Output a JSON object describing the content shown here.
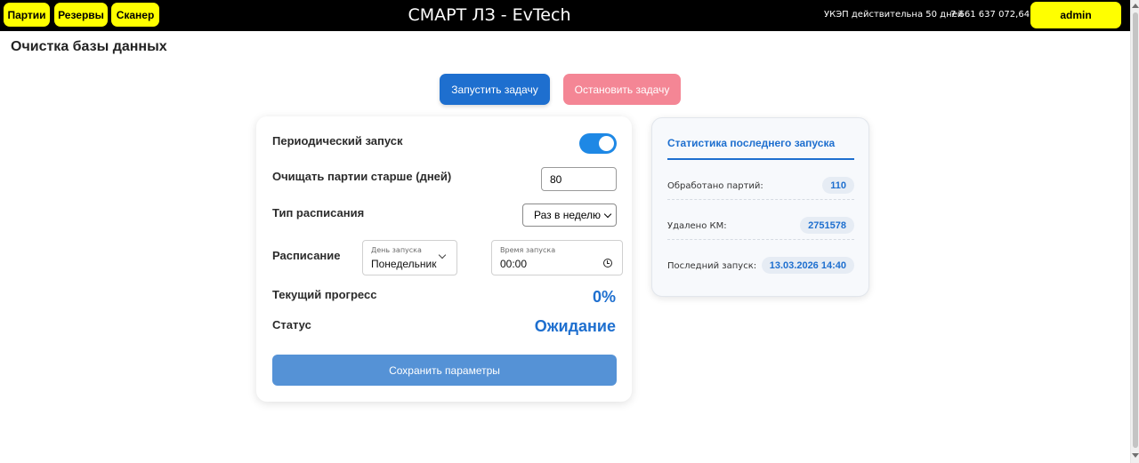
{
  "header": {
    "nav": [
      "Партии",
      "Резервы",
      "Сканер"
    ],
    "title": "СМАРТ ЛЗ - EvTech",
    "ukep": "УКЭП действительна 50 дней",
    "balance": "7 661 637 072,64 ₽",
    "user": "admin"
  },
  "page": {
    "title": "Очистка базы данных"
  },
  "actions": {
    "start": "Запустить задачу",
    "stop": "Остановить задачу"
  },
  "settings": {
    "periodic_label": "Периодический запуск",
    "periodic_enabled": true,
    "days_label": "Очищать партии старше (дней)",
    "days_value": "80",
    "schedule_type_label": "Тип расписания",
    "schedule_type_value": "Раз в неделю",
    "schedule_label": "Расписание",
    "day_caption": "День запуска",
    "day_value": "Понедельник",
    "time_caption": "Время запуска",
    "time_value": "00:00",
    "progress_label": "Текущий прогресс",
    "progress_value": "0%",
    "status_label": "Статус",
    "status_value": "Ожидание",
    "save": "Сохранить параметры"
  },
  "stats": {
    "title": "Статистика последнего запуска",
    "rows": [
      {
        "label": "Обработано партий:",
        "value": "110"
      },
      {
        "label": "Удалено КМ:",
        "value": "2751578"
      },
      {
        "label": "Последний запуск:",
        "value": "13.03.2026 14:40"
      }
    ]
  },
  "colors": {
    "topbar": "#000000",
    "nav_button": "#ffff00",
    "primary": "#1e6fcf",
    "danger_disabled": "#f48695",
    "toggle_on": "#1e88e5",
    "save_button": "#5592d6"
  },
  "icons": [
    "chevron-down-icon",
    "clock-icon"
  ]
}
